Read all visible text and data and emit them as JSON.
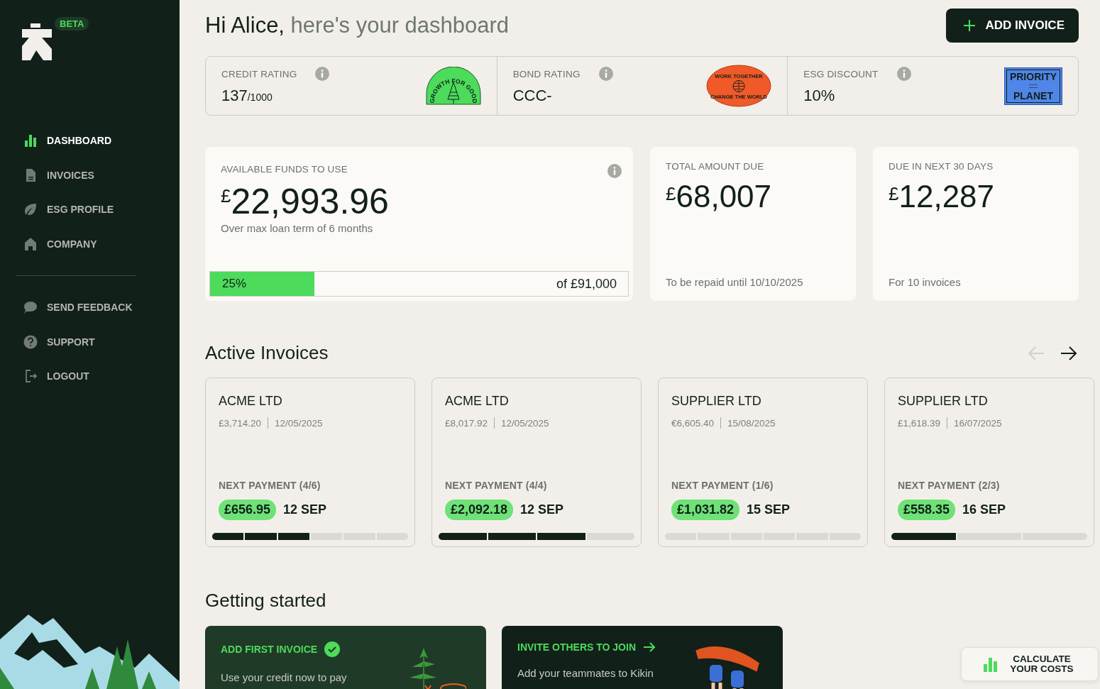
{
  "sidebar": {
    "badge": "BETA",
    "nav": [
      {
        "label": "DASHBOARD",
        "kind": "chart",
        "selected": true
      },
      {
        "label": "INVOICES",
        "kind": "document",
        "selected": false
      },
      {
        "label": "ESG PROFILE",
        "kind": "leaf",
        "selected": false
      },
      {
        "label": "COMPANY",
        "kind": "house",
        "selected": false
      }
    ],
    "secondary": [
      {
        "label": "SEND FEEDBACK",
        "kind": "chat"
      },
      {
        "label": "SUPPORT",
        "kind": "question"
      },
      {
        "label": "LOGOUT",
        "kind": "logout"
      }
    ]
  },
  "header": {
    "greeting": "Hi Alice,",
    "subtitle": "here's your dashboard",
    "add_button": "ADD INVOICE"
  },
  "ratings": [
    {
      "label": "CREDIT RATING",
      "value": "137",
      "suffix": "/1000",
      "sticker": {
        "kind": "arch",
        "lines": [
          "GROWTH FOR GOOD"
        ]
      }
    },
    {
      "label": "BOND RATING",
      "value": "CCC-",
      "sticker": {
        "kind": "globe",
        "lines": [
          "WORK TOGETHER",
          "CHANGE THE WORLD"
        ]
      }
    },
    {
      "label": "ESG DISCOUNT",
      "value": "10%",
      "sticker": {
        "kind": "label",
        "lines": [
          "PRIORITY",
          "PLANET"
        ]
      }
    }
  ],
  "available": {
    "label": "AVAILABLE FUNDS TO USE",
    "currency": "£",
    "amount": "22,993.96",
    "note": "Over max loan term of 6 months",
    "level": 0.25,
    "percent": "25%",
    "total": "of £91,000"
  },
  "stats": [
    {
      "label": "TOTAL AMOUNT DUE",
      "currency": "£",
      "amount": "68,007",
      "note": "To be repaid until 10/10/2025"
    },
    {
      "label": "DUE IN NEXT 30 DAYS",
      "currency": "£",
      "amount": "12,287",
      "note": "For 10 invoices"
    }
  ],
  "active_invoices": {
    "title": "Active Invoices",
    "prev_disabled": true,
    "next_disabled": false,
    "invoices": [
      {
        "company": "ACME LTD",
        "amount": "£3,714.20",
        "date": "12/05/2025",
        "next_label": "NEXT PAYMENT (4/6)",
        "payment": "£656.95",
        "payment_date": "12 SEP",
        "segments": [
          {
            "paid": true
          },
          {
            "paid": true
          },
          {
            "paid": true
          },
          {
            "paid": false
          },
          {
            "paid": false
          },
          {
            "paid": false
          }
        ]
      },
      {
        "company": "ACME LTD",
        "amount": "£8,017.92",
        "date": "12/05/2025",
        "next_label": "NEXT PAYMENT (4/4)",
        "payment": "£2,092.18",
        "payment_date": "12 SEP",
        "segments": [
          {
            "paid": true
          },
          {
            "paid": true
          },
          {
            "paid": true
          },
          {
            "paid": false
          }
        ]
      },
      {
        "company": "SUPPLIER LTD",
        "amount": "€6,605.40",
        "date": "15/08/2025",
        "next_label": "NEXT PAYMENT (1/6)",
        "payment": "£1,031.82",
        "payment_date": "15 SEP",
        "segments": [
          {
            "paid": false
          },
          {
            "paid": false
          },
          {
            "paid": false
          },
          {
            "paid": false
          },
          {
            "paid": false
          },
          {
            "paid": false
          }
        ]
      },
      {
        "company": "SUPPLIER LTD",
        "amount": "£1,618.39",
        "date": "16/07/2025",
        "next_label": "NEXT PAYMENT (2/3)",
        "payment": "£558.35",
        "payment_date": "16 SEP",
        "segments": [
          {
            "paid": true
          },
          {
            "paid": false
          },
          {
            "paid": false
          }
        ]
      }
    ]
  },
  "getting_started": {
    "title": "Getting started",
    "cards": [
      {
        "kind": "done",
        "title": "ADD FIRST INVOICE",
        "text": "Use your credit now to pay"
      },
      {
        "kind": "link",
        "title": "INVITE OTHERS TO JOIN",
        "text": "Add your teammates to Kikin"
      }
    ]
  },
  "calculator": {
    "label": "CALCULATE YOUR COSTS"
  }
}
